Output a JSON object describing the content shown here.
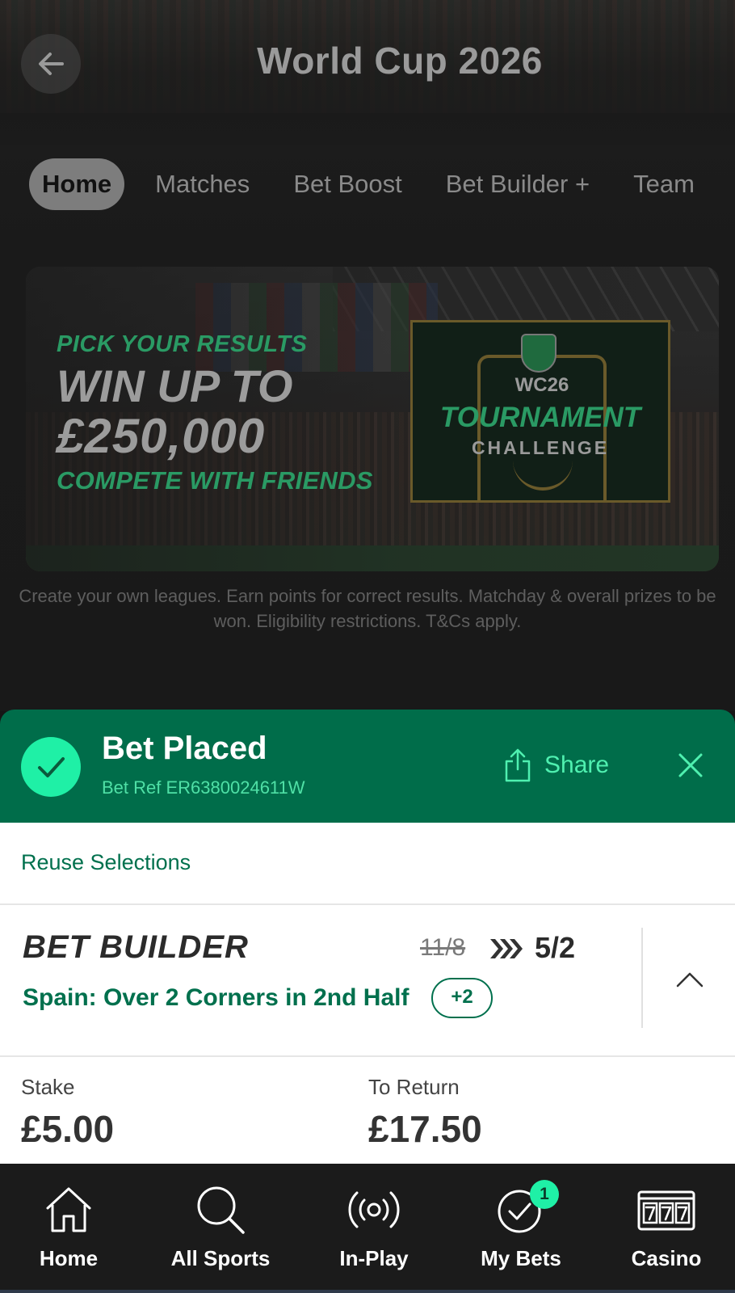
{
  "header": {
    "title": "World Cup 2026",
    "back_icon": "arrow-left-icon"
  },
  "tabs": [
    {
      "label": "Home",
      "active": true
    },
    {
      "label": "Matches",
      "active": false
    },
    {
      "label": "Bet Boost",
      "active": false
    },
    {
      "label": "Bet Builder +",
      "active": false
    },
    {
      "label": "Team",
      "active": false
    }
  ],
  "banner": {
    "line1": "PICK YOUR RESULTS",
    "line2": "WIN UP TO",
    "line3": "£250,000",
    "line4": "COMPETE WITH FRIENDS",
    "badge_small": "WC26",
    "badge_big": "TOURNAMENT",
    "badge_sub": "CHALLENGE",
    "caption": "Create your own leagues. Earn points for correct results. Matchday & overall prizes to be won. Eligibility restrictions. T&Cs apply."
  },
  "bet_placed": {
    "title": "Bet Placed",
    "ref": "Bet Ref ER6380024611W",
    "share_label": "Share",
    "accent": "#006d4a",
    "check_color": "#1ff0a6"
  },
  "reuse": {
    "label": "Reuse Selections"
  },
  "bet": {
    "type": "BET BUILDER",
    "old_odds": "11/8",
    "new_odds": "5/2",
    "selection": "Spain: Over 2 Corners in 2nd Half",
    "more": "+2"
  },
  "stake": {
    "stake_label": "Stake",
    "stake_value": "£5.00",
    "return_label": "To Return",
    "return_value": "£17.50"
  },
  "nav": [
    {
      "label": "Home",
      "icon": "home-icon"
    },
    {
      "label": "All Sports",
      "icon": "search-icon"
    },
    {
      "label": "In-Play",
      "icon": "live-broadcast-icon"
    },
    {
      "label": "My Bets",
      "icon": "check-circle-icon",
      "badge": "1"
    },
    {
      "label": "Casino",
      "icon": "slot-machine-icon"
    }
  ]
}
